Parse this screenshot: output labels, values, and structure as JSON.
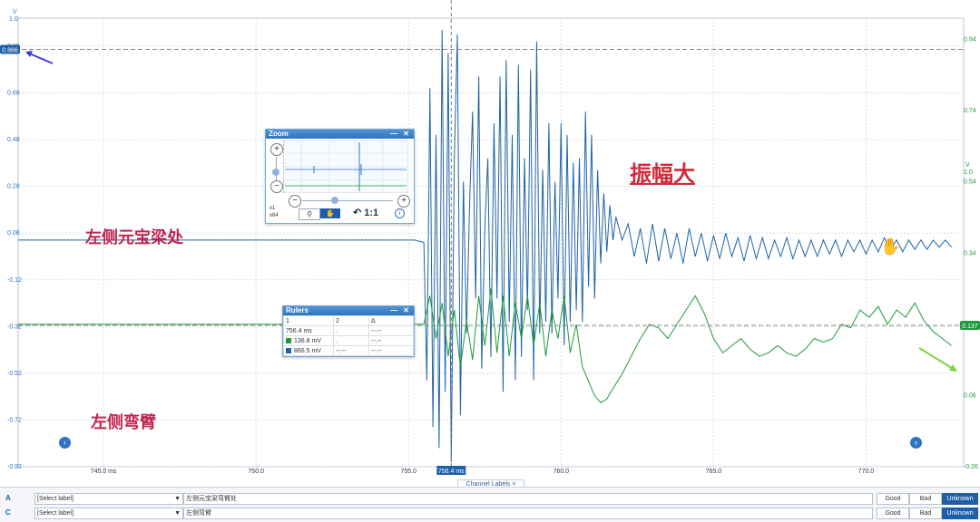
{
  "chart_data": {
    "type": "line",
    "x_unit": "ms",
    "x_ticks": [
      "745.0 ms",
      "750.0",
      "755.0",
      "760.0",
      "765.0",
      "770.0"
    ],
    "x_tick_values": [
      745,
      750,
      755,
      760,
      765,
      770
    ],
    "xlim": [
      742.2,
      773.2
    ],
    "left_axis": {
      "unit": "V",
      "top_label": "1.0",
      "ticks": [
        "0.88",
        "0.68",
        "0.48",
        "0.28",
        "0.08",
        "-0.12",
        "-0.32",
        "-0.52",
        "-0.72",
        "-0.92"
      ],
      "tick_values": [
        0.88,
        0.68,
        0.48,
        0.28,
        0.08,
        -0.12,
        -0.32,
        -0.52,
        -0.72,
        -0.92
      ],
      "ylim": [
        -0.92,
        1.0
      ],
      "color": "#2f74c0"
    },
    "right_axis": {
      "unit": "V",
      "top_label": "1.0",
      "ticks": [
        "0.94",
        "0.74",
        "0.54",
        "0.34",
        "0.14",
        "0.06",
        "-0.26"
      ],
      "tick_values": [
        0.94,
        0.74,
        0.54,
        0.34,
        0.14,
        -0.06,
        -0.26
      ],
      "ylim": [
        -0.26,
        1.0
      ],
      "color": "#1e9a3c"
    },
    "series": [
      {
        "channel": "A",
        "color": "#1f63a6",
        "axis": "left",
        "baseline": 0.05,
        "impact_start": 755.2,
        "points": [
          [
            755.5,
            0.04
          ],
          [
            755.6,
            -0.55
          ],
          [
            755.7,
            0.7
          ],
          [
            755.8,
            -0.75
          ],
          [
            755.9,
            0.5
          ],
          [
            756.0,
            -0.84
          ],
          [
            756.1,
            0.95
          ],
          [
            756.2,
            -0.6
          ],
          [
            756.3,
            0.85
          ],
          [
            756.4,
            -0.9
          ],
          [
            756.5,
            0.4
          ],
          [
            756.6,
            0.93
          ],
          [
            756.7,
            -0.7
          ],
          [
            756.8,
            0.3
          ],
          [
            756.9,
            -0.35
          ],
          [
            757.0,
            0.2
          ],
          [
            757.1,
            0.6
          ],
          [
            757.2,
            -0.2
          ],
          [
            757.3,
            0.75
          ],
          [
            757.4,
            -0.5
          ],
          [
            757.5,
            0.1
          ],
          [
            757.6,
            0.4
          ],
          [
            757.7,
            -0.45
          ],
          [
            757.8,
            0.55
          ],
          [
            757.9,
            -0.2
          ],
          [
            758.0,
            0.75
          ],
          [
            758.1,
            -0.6
          ],
          [
            758.2,
            0.82
          ],
          [
            758.3,
            -0.3
          ],
          [
            758.4,
            0.5
          ],
          [
            758.5,
            -0.55
          ],
          [
            758.6,
            0.8
          ],
          [
            758.7,
            -0.45
          ],
          [
            758.8,
            0.4
          ],
          [
            758.9,
            -0.25
          ],
          [
            759.0,
            0.78
          ],
          [
            759.1,
            -0.55
          ],
          [
            759.2,
            0.9
          ],
          [
            759.3,
            -0.35
          ],
          [
            759.4,
            0.35
          ],
          [
            759.5,
            -0.3
          ],
          [
            759.6,
            0.55
          ],
          [
            759.7,
            -0.35
          ],
          [
            759.8,
            0.3
          ],
          [
            759.9,
            -0.2
          ],
          [
            760.0,
            0.55
          ],
          [
            760.1,
            -0.4
          ],
          [
            760.2,
            0.5
          ],
          [
            760.3,
            -0.3
          ],
          [
            760.4,
            0.38
          ],
          [
            760.5,
            -0.25
          ],
          [
            760.6,
            0.4
          ],
          [
            760.7,
            -0.3
          ],
          [
            760.8,
            0.6
          ],
          [
            760.9,
            -0.15
          ],
          [
            761.0,
            0.5
          ],
          [
            761.1,
            -0.2
          ],
          [
            761.2,
            0.35
          ],
          [
            761.3,
            -0.05
          ],
          [
            761.4,
            0.25
          ],
          [
            761.5,
            0.0
          ],
          [
            761.6,
            0.2
          ],
          [
            761.7,
            0.05
          ],
          [
            761.8,
            0.15
          ],
          [
            762.0,
            0.05
          ],
          [
            762.2,
            0.12
          ],
          [
            762.4,
            -0.02
          ],
          [
            762.6,
            0.1
          ],
          [
            762.8,
            -0.05
          ],
          [
            763.0,
            0.12
          ],
          [
            763.2,
            -0.04
          ],
          [
            763.4,
            0.1
          ],
          [
            763.6,
            -0.03
          ],
          [
            763.8,
            0.08
          ],
          [
            764.0,
            -0.05
          ],
          [
            764.2,
            0.1
          ],
          [
            764.4,
            -0.02
          ],
          [
            764.6,
            0.08
          ],
          [
            764.8,
            -0.04
          ],
          [
            765.0,
            0.07
          ],
          [
            765.2,
            -0.03
          ],
          [
            765.4,
            0.08
          ],
          [
            765.6,
            -0.02
          ],
          [
            765.8,
            0.06
          ],
          [
            766.0,
            -0.04
          ],
          [
            766.2,
            0.07
          ],
          [
            766.4,
            -0.03
          ],
          [
            766.6,
            0.06
          ],
          [
            766.8,
            -0.03
          ],
          [
            767.0,
            0.05
          ],
          [
            767.2,
            -0.02
          ],
          [
            767.4,
            0.06
          ],
          [
            767.6,
            -0.03
          ],
          [
            767.8,
            0.05
          ],
          [
            768.0,
            -0.02
          ],
          [
            768.2,
            0.05
          ],
          [
            768.4,
            -0.02
          ],
          [
            768.6,
            0.05
          ],
          [
            768.8,
            -0.01
          ],
          [
            769.0,
            0.05
          ],
          [
            769.2,
            -0.02
          ],
          [
            769.4,
            0.05
          ],
          [
            769.6,
            0.0
          ],
          [
            769.8,
            0.05
          ],
          [
            770.0,
            -0.01
          ],
          [
            770.2,
            0.05
          ],
          [
            770.4,
            0.0
          ],
          [
            770.6,
            0.06
          ],
          [
            770.8,
            0.01
          ],
          [
            771.0,
            0.05
          ],
          [
            771.2,
            0.0
          ],
          [
            771.4,
            0.05
          ],
          [
            771.6,
            0.01
          ],
          [
            771.8,
            0.05
          ],
          [
            772.0,
            0.01
          ],
          [
            772.2,
            0.05
          ],
          [
            772.4,
            0.02
          ],
          [
            772.6,
            0.05
          ],
          [
            772.8,
            0.02
          ]
        ]
      },
      {
        "channel": "C",
        "color": "#1e9a3c",
        "axis": "right",
        "baseline": 0.14,
        "impact_start": 755.4,
        "points": [
          [
            755.5,
            0.14
          ],
          [
            755.7,
            0.22
          ],
          [
            755.9,
            0.1
          ],
          [
            756.1,
            0.2
          ],
          [
            756.3,
            0.05
          ],
          [
            756.5,
            0.18
          ],
          [
            756.7,
            0.02
          ],
          [
            756.9,
            0.15
          ],
          [
            757.1,
            0.04
          ],
          [
            757.3,
            0.22
          ],
          [
            757.5,
            0.08
          ],
          [
            757.7,
            0.24
          ],
          [
            757.9,
            0.06
          ],
          [
            758.1,
            0.22
          ],
          [
            758.3,
            0.05
          ],
          [
            758.5,
            0.2
          ],
          [
            758.7,
            0.1
          ],
          [
            758.9,
            0.22
          ],
          [
            759.1,
            0.08
          ],
          [
            759.3,
            0.2
          ],
          [
            759.5,
            0.05
          ],
          [
            759.7,
            0.18
          ],
          [
            759.9,
            0.1
          ],
          [
            760.1,
            0.22
          ],
          [
            760.3,
            0.06
          ],
          [
            760.5,
            0.14
          ],
          [
            760.7,
            0.02
          ],
          [
            760.9,
            -0.02
          ],
          [
            761.1,
            -0.06
          ],
          [
            761.3,
            -0.08
          ],
          [
            761.5,
            -0.07
          ],
          [
            761.7,
            -0.04
          ],
          [
            762.0,
            0.0
          ],
          [
            762.3,
            0.05
          ],
          [
            762.6,
            0.1
          ],
          [
            762.9,
            0.14
          ],
          [
            763.2,
            0.13
          ],
          [
            763.5,
            0.1
          ],
          [
            763.8,
            0.14
          ],
          [
            764.1,
            0.18
          ],
          [
            764.4,
            0.22
          ],
          [
            764.7,
            0.17
          ],
          [
            765.0,
            0.1
          ],
          [
            765.3,
            0.06
          ],
          [
            765.6,
            0.08
          ],
          [
            765.9,
            0.1
          ],
          [
            766.2,
            0.07
          ],
          [
            766.5,
            0.05
          ],
          [
            766.8,
            0.06
          ],
          [
            767.1,
            0.08
          ],
          [
            767.4,
            0.06
          ],
          [
            767.7,
            0.05
          ],
          [
            768.0,
            0.07
          ],
          [
            768.3,
            0.1
          ],
          [
            768.6,
            0.09
          ],
          [
            768.9,
            0.1
          ],
          [
            769.2,
            0.14
          ],
          [
            769.5,
            0.13
          ],
          [
            769.8,
            0.18
          ],
          [
            770.1,
            0.16
          ],
          [
            770.4,
            0.19
          ],
          [
            770.7,
            0.14
          ],
          [
            771.0,
            0.18
          ],
          [
            771.3,
            0.16
          ],
          [
            771.6,
            0.2
          ],
          [
            771.9,
            0.15
          ],
          [
            772.2,
            0.12
          ],
          [
            772.5,
            0.1
          ],
          [
            772.8,
            0.08
          ]
        ]
      }
    ],
    "cursor": {
      "x": 756.4,
      "label": "756.4 ms"
    },
    "left_marker": {
      "value": 0.866,
      "label": "0.866"
    },
    "right_marker": {
      "value": 0.137,
      "label": "0.137"
    }
  },
  "annotations": {
    "big_amplitude": "振幅大",
    "left_beam": "左侧元宝梁处",
    "left_arm": "左侧弯臂"
  },
  "zoom_panel": {
    "title": "Zoom",
    "controls": "— ✕",
    "zoom_in": "+",
    "zoom_out": "−",
    "scale_x": "x1",
    "scale_y": "x64",
    "ratio_label": "1:1",
    "info": "i"
  },
  "rulers_panel": {
    "title": "Rulers",
    "controls": "— ✕",
    "headers": [
      "1",
      "2",
      "Δ"
    ],
    "rows": [
      {
        "swatch": "",
        "col1": "756.4 ms",
        "col2": ".",
        "delta": "--.--"
      },
      {
        "swatch": "#1e9a3c",
        "col1": "136.8 mV",
        "col2": ".",
        "delta": "--.--"
      },
      {
        "swatch": "#1f63a6",
        "col1": "866.5 mV",
        "col2": "--.--",
        "delta": "--.--"
      }
    ]
  },
  "channel_labels_tab": "Channel Labels ×",
  "bottom_rows": [
    {
      "letter": "A",
      "select": "[Select label]",
      "field": "左侧元宝梁弯臂处",
      "good": "Good",
      "bad": "Bad",
      "unknown": "Unknown"
    },
    {
      "letter": "C",
      "select": "[Select label]",
      "field": "左侧弯臂",
      "good": "Good",
      "bad": "Bad",
      "unknown": "Unknown"
    }
  ]
}
